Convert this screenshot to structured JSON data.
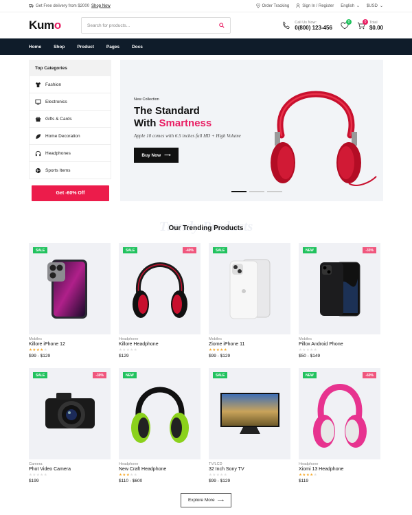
{
  "topbar": {
    "delivery_text": "Get Free delivery from $2000",
    "shop_now": "Shop Now",
    "order_tracking": "Order Tracking",
    "sign_in": "Sign In / Register",
    "language": "English",
    "currency": "$USD"
  },
  "header": {
    "logo_prefix": "Kum",
    "logo_o": "o",
    "search_placeholder": "Search for products...",
    "call_label": "Call Us Now:",
    "call_number": "0(800) 123-456",
    "wishlist_count": "0",
    "cart_count": "0",
    "cart_label": "Total",
    "cart_total": "$0.00"
  },
  "nav": [
    "Home",
    "Shop",
    "Product",
    "Pages",
    "Docs"
  ],
  "categories": {
    "title": "Top Categories",
    "items": [
      "Fashion",
      "Electronics",
      "Gifts & Cards",
      "Home Decoration",
      "Headphones",
      "Sports Items"
    ],
    "offer": "Get -60% Off"
  },
  "banner": {
    "kicker": "New Collection",
    "title_line1": "The Standard",
    "title_line2a": "With ",
    "title_line2b": "Smartness",
    "subtitle": "Apple 10 comes with 6.5 inches full HD + High Volume",
    "button": "Buy Now"
  },
  "trending": {
    "ghost": "Trendy Products",
    "title": "Our Trending Products"
  },
  "products": [
    {
      "left_tag": "SALE",
      "right_tag": "",
      "category": "Mobiles",
      "name": "Killore iPhone 12",
      "rating": 4,
      "price": "$99 - $129"
    },
    {
      "left_tag": "SALE",
      "right_tag": "-40%",
      "category": "Headphone",
      "name": "Killore Headphone",
      "rating": 0,
      "price": "$129"
    },
    {
      "left_tag": "SALE",
      "right_tag": "",
      "category": "Mobiles",
      "name": "Ziome iPhone 11",
      "rating": 5,
      "price": "$99 - $129"
    },
    {
      "left_tag": "NEW",
      "right_tag": "-33%",
      "category": "Mobiles",
      "name": "Pillox Android Phone",
      "rating": 0,
      "price": "$50 - $149"
    },
    {
      "left_tag": "SALE",
      "right_tag": "-30%",
      "category": "Camera",
      "name": "Phot Video Camera",
      "rating": 0,
      "price": "$199"
    },
    {
      "left_tag": "NEW",
      "right_tag": "",
      "category": "Headphone",
      "name": "New Craft Headphone",
      "rating": 3,
      "price": "$110 - $600"
    },
    {
      "left_tag": "SALE",
      "right_tag": "",
      "category": "TV/LCD",
      "name": "32 Inch Sony TV",
      "rating": 0,
      "price": "$99 - $129"
    },
    {
      "left_tag": "NEW",
      "right_tag": "-60%",
      "category": "Headphone",
      "name": "Xiomi 13 Headphone",
      "rating": 4,
      "price": "$119"
    }
  ],
  "explore": "Explore More",
  "colors": {
    "accent": "#e91e63",
    "nav_bg": "#0f1c2a",
    "sale": "#21c25e",
    "discount": "#f0567d",
    "offer": "#ec1c4b"
  }
}
